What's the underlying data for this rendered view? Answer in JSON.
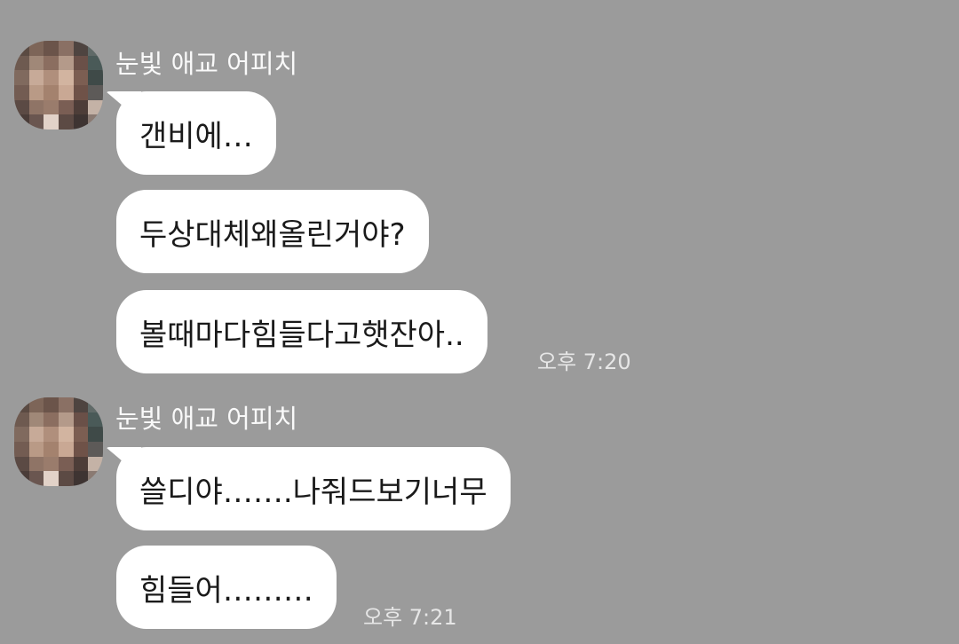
{
  "conversation": {
    "groups": [
      {
        "sender": "눈빛 애교 어피치",
        "messages": [
          "갠비에…",
          "두상대체왜올린거야?",
          "볼때마다힘들다고햇잔아.."
        ],
        "time": "오후 7:20"
      },
      {
        "sender": "눈빛 애교 어피치",
        "messages": [
          "쓸디야…….나줘드보기너무",
          "힘들어………"
        ],
        "time": "오후 7:21"
      }
    ]
  },
  "colors": {
    "background": "#9b9b9b",
    "bubble": "#ffffff",
    "text": "#1a1a1a",
    "meta_text": "#e6e6e6"
  },
  "avatar": {
    "style": "pixelated-mosaic",
    "tiles": [
      "#5a4a42",
      "#7d6558",
      "#6b544a",
      "#8a7064",
      "#4e4440",
      "#606a68",
      "#6e5a50",
      "#a08878",
      "#8b6e60",
      "#b49a8a",
      "#6a5048",
      "#4a5a58",
      "#806a5e",
      "#c7aa98",
      "#b08f7c",
      "#d2b4a0",
      "#7c5e52",
      "#3f4a48",
      "#735c52",
      "#b99a86",
      "#a4826e",
      "#c9a894",
      "#6f5248",
      "#5d5a58",
      "#5b4a44",
      "#8f7466",
      "#9a7c6c",
      "#7a5e54",
      "#4d3d38",
      "#c4b2a6",
      "#4a3c38",
      "#6a5650",
      "#e2d2c8",
      "#5c4a44",
      "#3e3432",
      "#8a7a72"
    ]
  }
}
